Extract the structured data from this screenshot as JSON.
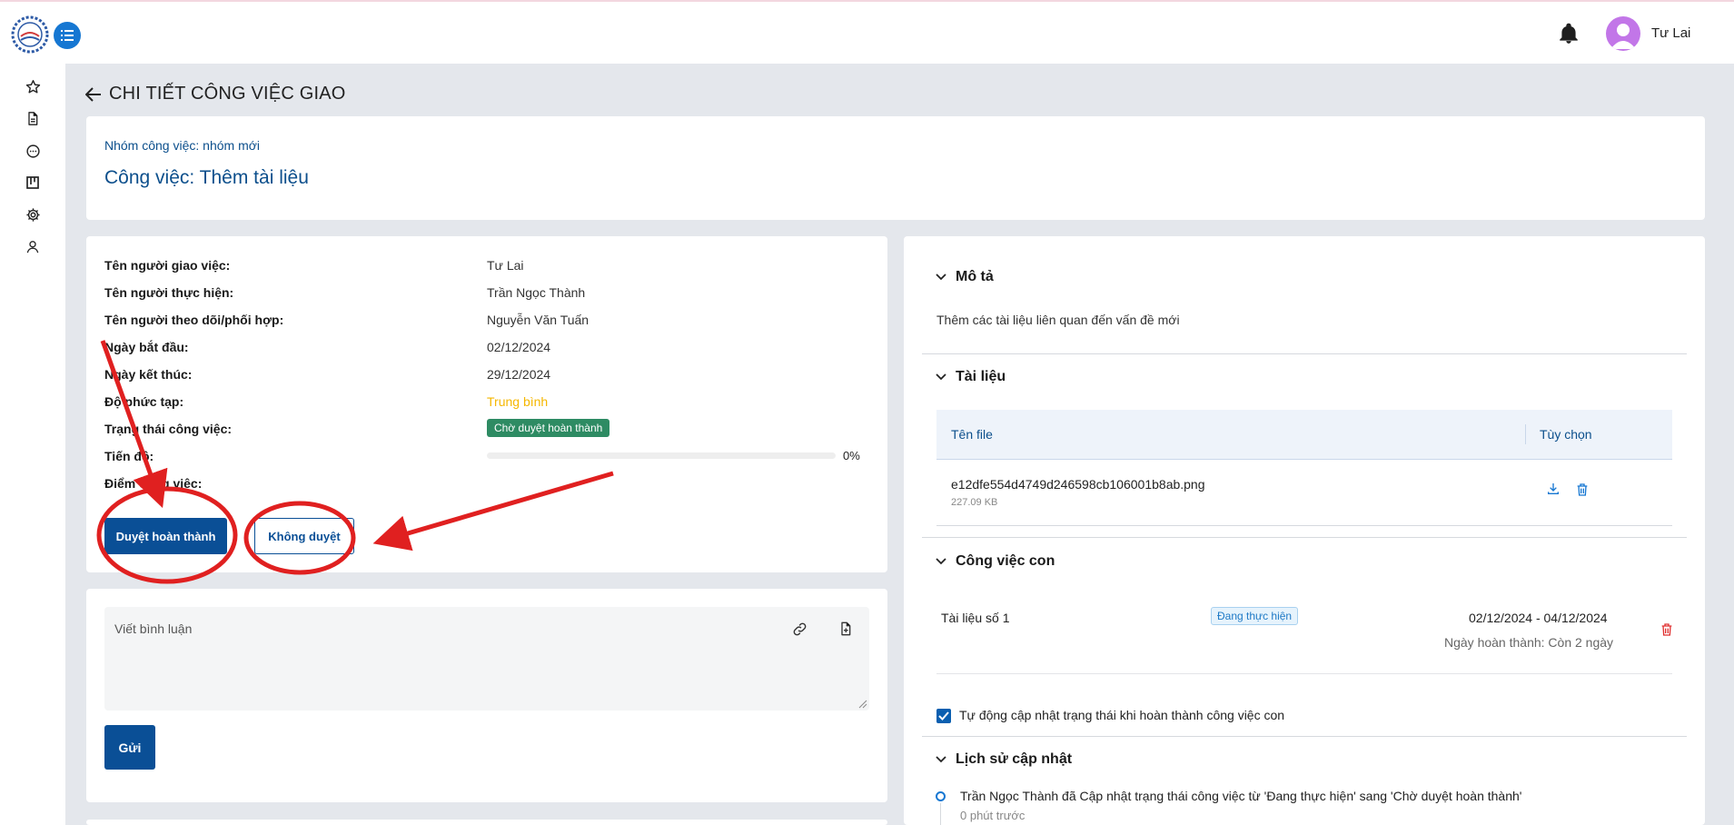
{
  "header": {
    "username": "Tư Lai"
  },
  "page": {
    "title": "CHI TIẾT CÔNG VIỆC GIAO"
  },
  "task": {
    "group_label": "Nhóm công việc: nhóm mới",
    "title": "Công việc: Thêm tài liệu"
  },
  "info": {
    "assigner_label": "Tên người giao việc:",
    "assigner_value": "Tư Lai",
    "executor_label": "Tên người thực hiện:",
    "executor_value": "Trần Ngọc Thành",
    "follower_label": "Tên người theo dõi/phối hợp:",
    "follower_value": "Nguyễn Văn Tuấn",
    "start_label": "Ngày bắt đầu:",
    "start_value": "02/12/2024",
    "end_label": "Ngày kết thúc:",
    "end_value": "29/12/2024",
    "complexity_label": "Độ phức tạp:",
    "complexity_value": "Trung bình",
    "status_label": "Trạng thái công việc:",
    "status_value": "Chờ duyệt hoàn thành",
    "progress_label": "Tiến độ:",
    "progress_value": 0,
    "progress_text": "0%",
    "score_label": "Điểm công việc:"
  },
  "actions": {
    "approve_label": "Duyệt hoàn thành",
    "reject_label": "Không duyệt"
  },
  "comment": {
    "placeholder": "Viết bình luận",
    "send_label": "Gửi"
  },
  "description": {
    "heading": "Mô tả",
    "text": "Thêm các tài liệu liên quan đến vấn đề mới"
  },
  "documents": {
    "heading": "Tài liệu",
    "col_name": "Tên file",
    "col_options": "Tùy chọn",
    "files": [
      {
        "name": "e12dfe554d4749d246598cb106001b8ab.png",
        "size": "227.09 KB"
      }
    ]
  },
  "subtasks": {
    "heading": "Công việc con",
    "items": [
      {
        "name": "Tài liệu số 1",
        "status": "Đang thực hiện",
        "dates": "02/12/2024 - 04/12/2024",
        "completion": "Ngày hoàn thành: Còn 2 ngày"
      }
    ],
    "auto_update_label": "Tự động cập nhật trạng thái khi hoàn thành công việc con"
  },
  "history": {
    "heading": "Lịch sử cập nhật",
    "items": [
      {
        "text": "Trần Ngọc Thành đã Cập nhật trạng thái công việc từ 'Đang thực hiện' sang 'Chờ duyệt hoàn thành'",
        "time": "0 phút trước"
      }
    ]
  },
  "colors": {
    "primary": "#0a4f96",
    "status_green": "#2e8b63",
    "complexity": "#f5b700",
    "annotation_red": "#e02020"
  }
}
